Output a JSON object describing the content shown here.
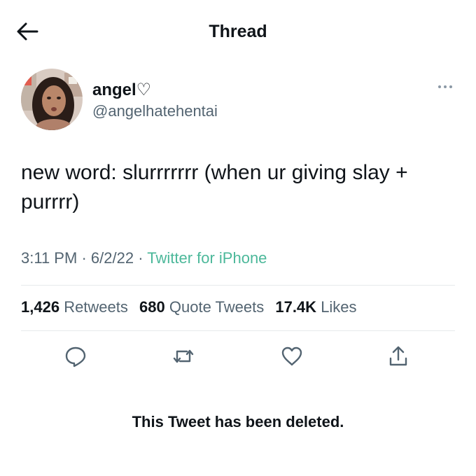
{
  "header": {
    "title": "Thread",
    "back_icon": "arrow-left-icon"
  },
  "tweet": {
    "author": {
      "name": "angel♡",
      "handle": "@angelhatehentai"
    },
    "text": "new word: slurrrrrrr (when ur giving slay + purrrr)",
    "time": "3:11 PM",
    "separator": "·",
    "date": "6/2/22",
    "source": "Twitter for iPhone",
    "stats": {
      "retweets_count": "1,426",
      "retweets_label": "Retweets",
      "quotes_count": "680",
      "quotes_label": "Quote Tweets",
      "likes_count": "17.4K",
      "likes_label": "Likes"
    },
    "actions": [
      "reply-icon",
      "retweet-icon",
      "like-icon",
      "share-icon"
    ]
  },
  "deleted_notice": "This Tweet has been deleted.",
  "colors": {
    "text": "#0f1419",
    "secondary": "#536471",
    "source_link": "#4cb89a",
    "divider": "#e6e9ec"
  }
}
